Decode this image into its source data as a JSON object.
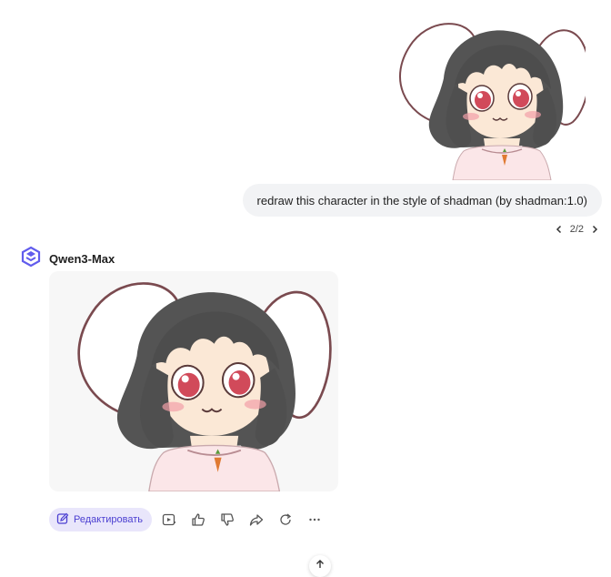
{
  "user_message": {
    "text": "redraw this character in the style of shadman (by shadman:1.0)"
  },
  "pager": {
    "current": "2",
    "separator": "/",
    "total": "2"
  },
  "assistant": {
    "model_name": "Qwen3-Max",
    "edit_label": "Редактировать"
  },
  "icons": {
    "prev": "chevron-left-icon",
    "next": "chevron-right-icon",
    "logo": "qwen-logo-icon",
    "edit": "edit-pencil-icon",
    "video": "video-generate-icon",
    "like": "thumbs-up-icon",
    "dislike": "thumbs-down-icon",
    "share": "share-icon",
    "regenerate": "regenerate-icon",
    "more": "more-dots-icon",
    "scroll_top": "arrow-up-icon"
  },
  "colors": {
    "accent": "#615ced",
    "edit_bg": "#e9e6fb",
    "bubble_bg": "#f2f3f5"
  }
}
